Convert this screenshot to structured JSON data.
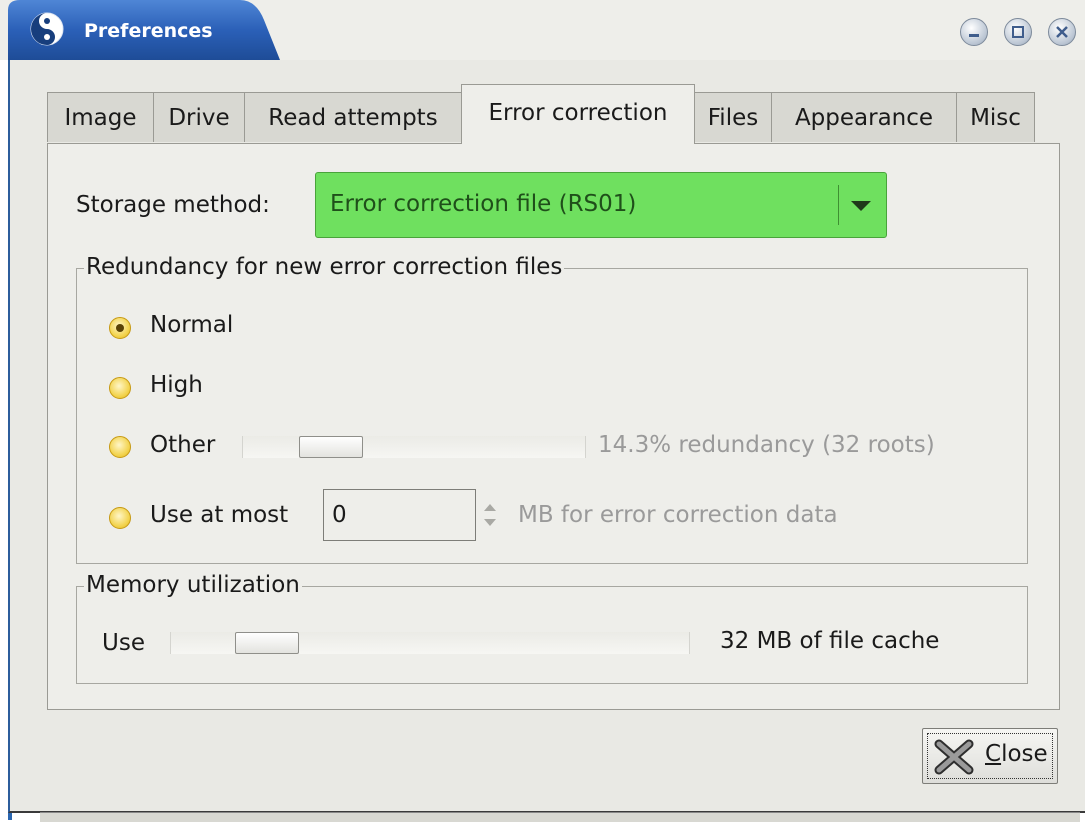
{
  "window": {
    "title": "Preferences",
    "app_icon": "yin-yang-icon",
    "controls": [
      "minimize-icon",
      "maximize-icon",
      "close-icon"
    ]
  },
  "tabs": [
    "Image",
    "Drive",
    "Read attempts",
    "Error correction",
    "Files",
    "Appearance",
    "Misc"
  ],
  "active_tab": "Error correction",
  "storage": {
    "label": "Storage method:",
    "value": "Error correction file (RS01)",
    "color": "#6fe05f"
  },
  "redundancy": {
    "title": "Redundancy for new error correction files",
    "options": {
      "normal": "Normal",
      "high": "High",
      "other": "Other",
      "use_at_most": "Use at most"
    },
    "selected": "Normal",
    "other_info": "14.3% redundancy (32 roots)",
    "other_slider_fraction": 0.2,
    "use_at_most_value": "0",
    "use_at_most_suffix": "MB for error correction data"
  },
  "memory": {
    "title": "Memory utilization",
    "use_label": "Use",
    "slider_fraction": 0.14,
    "cache_text": "32 MB of file cache"
  },
  "buttons": {
    "close_mnemonic": "C",
    "close_rest": "lose",
    "close_icon": "x-icon"
  }
}
